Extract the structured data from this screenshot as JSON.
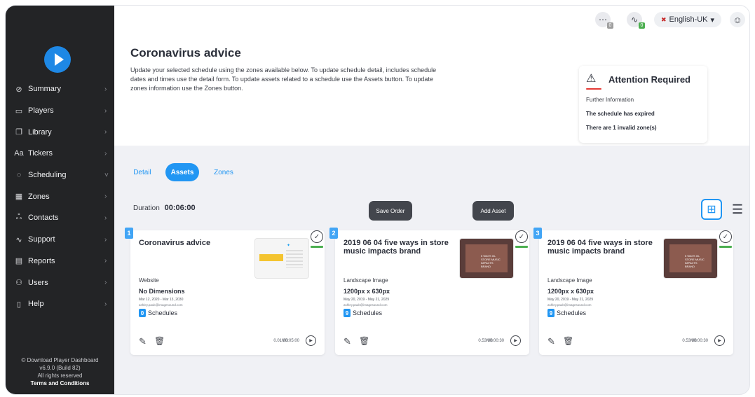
{
  "sidebar": {
    "items": [
      {
        "label": "Summary",
        "icon": "⊘",
        "chev": "›"
      },
      {
        "label": "Players",
        "icon": "▭",
        "chev": "›"
      },
      {
        "label": "Library",
        "icon": "❐",
        "chev": "›"
      },
      {
        "label": "Tickers",
        "icon": "Aa",
        "chev": "›"
      },
      {
        "label": "Scheduling",
        "icon": "◌",
        "chev": "˅"
      },
      {
        "label": "Zones",
        "icon": "▦",
        "chev": "›"
      },
      {
        "label": "Contacts",
        "icon": "ஃ",
        "chev": "›"
      },
      {
        "label": "Support",
        "icon": "∿",
        "chev": "›"
      },
      {
        "label": "Reports",
        "icon": "▤",
        "chev": "›"
      },
      {
        "label": "Users",
        "icon": "⚇",
        "chev": "›"
      },
      {
        "label": "Help",
        "icon": "▯",
        "chev": "›"
      }
    ],
    "footer": {
      "copyright": "© Download Player Dashboard",
      "version": "v6.9.0 (Build 82)",
      "rights": "All rights reserved",
      "terms": "Terms and Conditions"
    }
  },
  "topbar": {
    "messages_badge": "0",
    "activity_badge": "0",
    "language": "English-UK",
    "language_caret": "▾"
  },
  "header": {
    "title": "Coronavirus advice",
    "description": "Update your selected schedule using the zones available below. To update schedule detail, includes schedule dates and times use the detail form. To update assets related to a schedule use the Assets button. To update zones information use the Zones button."
  },
  "attention": {
    "icon": "⚠",
    "title": "Attention Required",
    "info": "Further Information",
    "messages": [
      "The schedule has expired",
      "There are 1 invalid zone(s)"
    ]
  },
  "tabs": [
    "Detail",
    "Assets",
    "Zones"
  ],
  "controls": {
    "duration_label": "Duration",
    "duration_value": "00:06:00",
    "save_order": "Save Order",
    "add_asset": "Add Asset"
  },
  "cards": [
    {
      "num": "1",
      "title": "Coronavirus advice",
      "type": "Website",
      "dimensions": "No Dimensions",
      "dates": "Mar 12, 2020 - Mar 13, 2030",
      "email": "ashley.pauk@imagesound.com",
      "schedules_count": "0",
      "schedules_label": "Schedules",
      "size": "0.01MB",
      "duration": "00:05:00"
    },
    {
      "num": "2",
      "title": "2019 06 04 five ways in store music impacts brand",
      "type": "Landscape Image",
      "dimensions": "1200px x 630px",
      "dates": "May 20, 2019 - May 21, 2029",
      "email": "ashley.pauk@imagesound.com",
      "schedules_count": "9",
      "schedules_label": "Schedules",
      "size": "0.53MB",
      "duration": "00:00:30"
    },
    {
      "num": "3",
      "title": "2019 06 04 five ways in store music impacts brand",
      "type": "Landscape Image",
      "dimensions": "1200px x 630px",
      "dates": "May 20, 2019 - May 21, 2029",
      "email": "ashley.pauk@imagesound.com",
      "schedules_count": "9",
      "schedules_label": "Schedules",
      "size": "0.53MB",
      "duration": "00:00:30"
    }
  ],
  "thumb_text": "5 WAYS IN-STORE MUSIC IMPACTS BRAND"
}
